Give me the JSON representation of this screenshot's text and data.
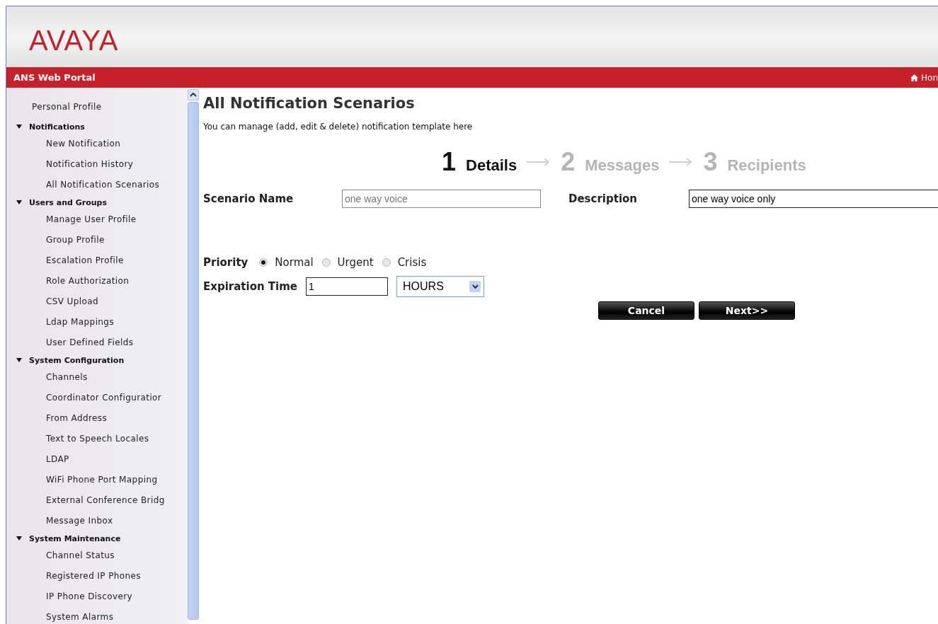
{
  "header": {
    "logo": "AVAYA"
  },
  "nav_bar": {
    "title": "ANS Web Portal",
    "home_link": "Hon"
  },
  "sidebar": {
    "items": [
      {
        "label": "Personal Profile",
        "kind": "link"
      },
      {
        "label": "Notifications",
        "kind": "group",
        "expanded": true,
        "children": [
          {
            "label": "New Notification"
          },
          {
            "label": "Notification History"
          },
          {
            "label": "All Notification Scenarios"
          }
        ]
      },
      {
        "label": "Users and Groups",
        "kind": "group",
        "expanded": true,
        "children": [
          {
            "label": "Manage User Profile"
          },
          {
            "label": "Group Profile"
          },
          {
            "label": "Escalation Profile"
          },
          {
            "label": "Role Authorization"
          },
          {
            "label": "CSV Upload"
          },
          {
            "label": "Ldap Mappings"
          },
          {
            "label": "User Defined Fields"
          }
        ]
      },
      {
        "label": "System Configuration",
        "kind": "group",
        "expanded": true,
        "children": [
          {
            "label": "Channels"
          },
          {
            "label": "Coordinator Configuratior"
          },
          {
            "label": "From Address"
          },
          {
            "label": "Text to Speech Locales"
          },
          {
            "label": "LDAP"
          },
          {
            "label": "WiFi Phone Port Mapping"
          },
          {
            "label": "External Conference Bridg"
          },
          {
            "label": "Message Inbox"
          }
        ]
      },
      {
        "label": "System Maintenance",
        "kind": "group",
        "expanded": true,
        "children": [
          {
            "label": "Channel Status"
          },
          {
            "label": "Registered IP Phones"
          },
          {
            "label": "IP Phone Discovery"
          },
          {
            "label": "System Alarms"
          }
        ]
      }
    ]
  },
  "page": {
    "title": "All Notification Scenarios",
    "subtitle": "You can manage (add, edit & delete) notification template here"
  },
  "steps": [
    {
      "number": "1",
      "label": "Details",
      "selected": true
    },
    {
      "number": "2",
      "label": "Messages",
      "selected": false
    },
    {
      "number": "3",
      "label": "Recipients",
      "selected": false
    }
  ],
  "form": {
    "scenario_name": {
      "label": "Scenario Name",
      "placeholder": "one way voice"
    },
    "description": {
      "label": "Description",
      "value": "one way voice only"
    },
    "priority": {
      "label": "Priority",
      "options": [
        {
          "label": "Normal",
          "selected": true
        },
        {
          "label": "Urgent",
          "selected": false
        },
        {
          "label": "Crisis",
          "selected": false
        }
      ]
    },
    "expiration": {
      "label": "Expiration Time",
      "value": "1",
      "unit": "HOURS"
    }
  },
  "buttons": [
    "Cancel",
    "Next>>"
  ]
}
